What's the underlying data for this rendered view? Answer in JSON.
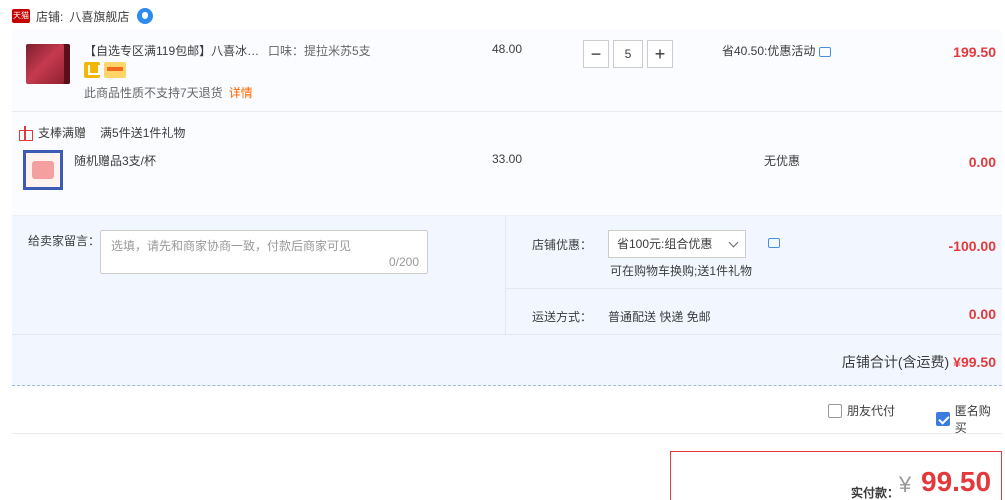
{
  "shop": {
    "badge": "天猫",
    "label": "店铺:",
    "name": "八喜旗舰店"
  },
  "item": {
    "title": "【自选专区满119包邮】八喜冰淇淋",
    "flavor": "口味：提拉米苏5支",
    "note": "此商品性质不支持7天退货",
    "detail_link": "详情",
    "price": "48.00",
    "quantity": "5",
    "minus": "−",
    "plus": "+",
    "discount": "省40.50:优惠活动",
    "subtotal": "199.50"
  },
  "gift": {
    "heading": "支棒满赠",
    "rule": "满5件送1件礼物",
    "name": "随机赠品3支/杯",
    "price": "33.00",
    "discount": "无优惠",
    "subtotal": "0.00"
  },
  "message": {
    "label": "给卖家留言：",
    "placeholder": "选填，请先和商家协商一致，付款后商家可见",
    "count": "0/200"
  },
  "coupon": {
    "label": "店铺优惠：",
    "selected": "省100元:组合优惠",
    "note": "可在购物车换购;送1件礼物",
    "amount": "-100.00"
  },
  "shipping": {
    "label": "运送方式：",
    "value": "普通配送 快递 免邮",
    "amount": "0.00"
  },
  "shop_total": {
    "label": "店铺合计(含运费)",
    "amount": "¥99.50"
  },
  "options": {
    "friend_pay": "朋友代付",
    "anonymous": "匿名购买"
  },
  "payment": {
    "label": "实付款：",
    "currency": "¥",
    "amount": "99.50"
  },
  "colors": {
    "accent": "#e4393c",
    "link": "#ff6600",
    "panel": "#f2f7ff"
  }
}
